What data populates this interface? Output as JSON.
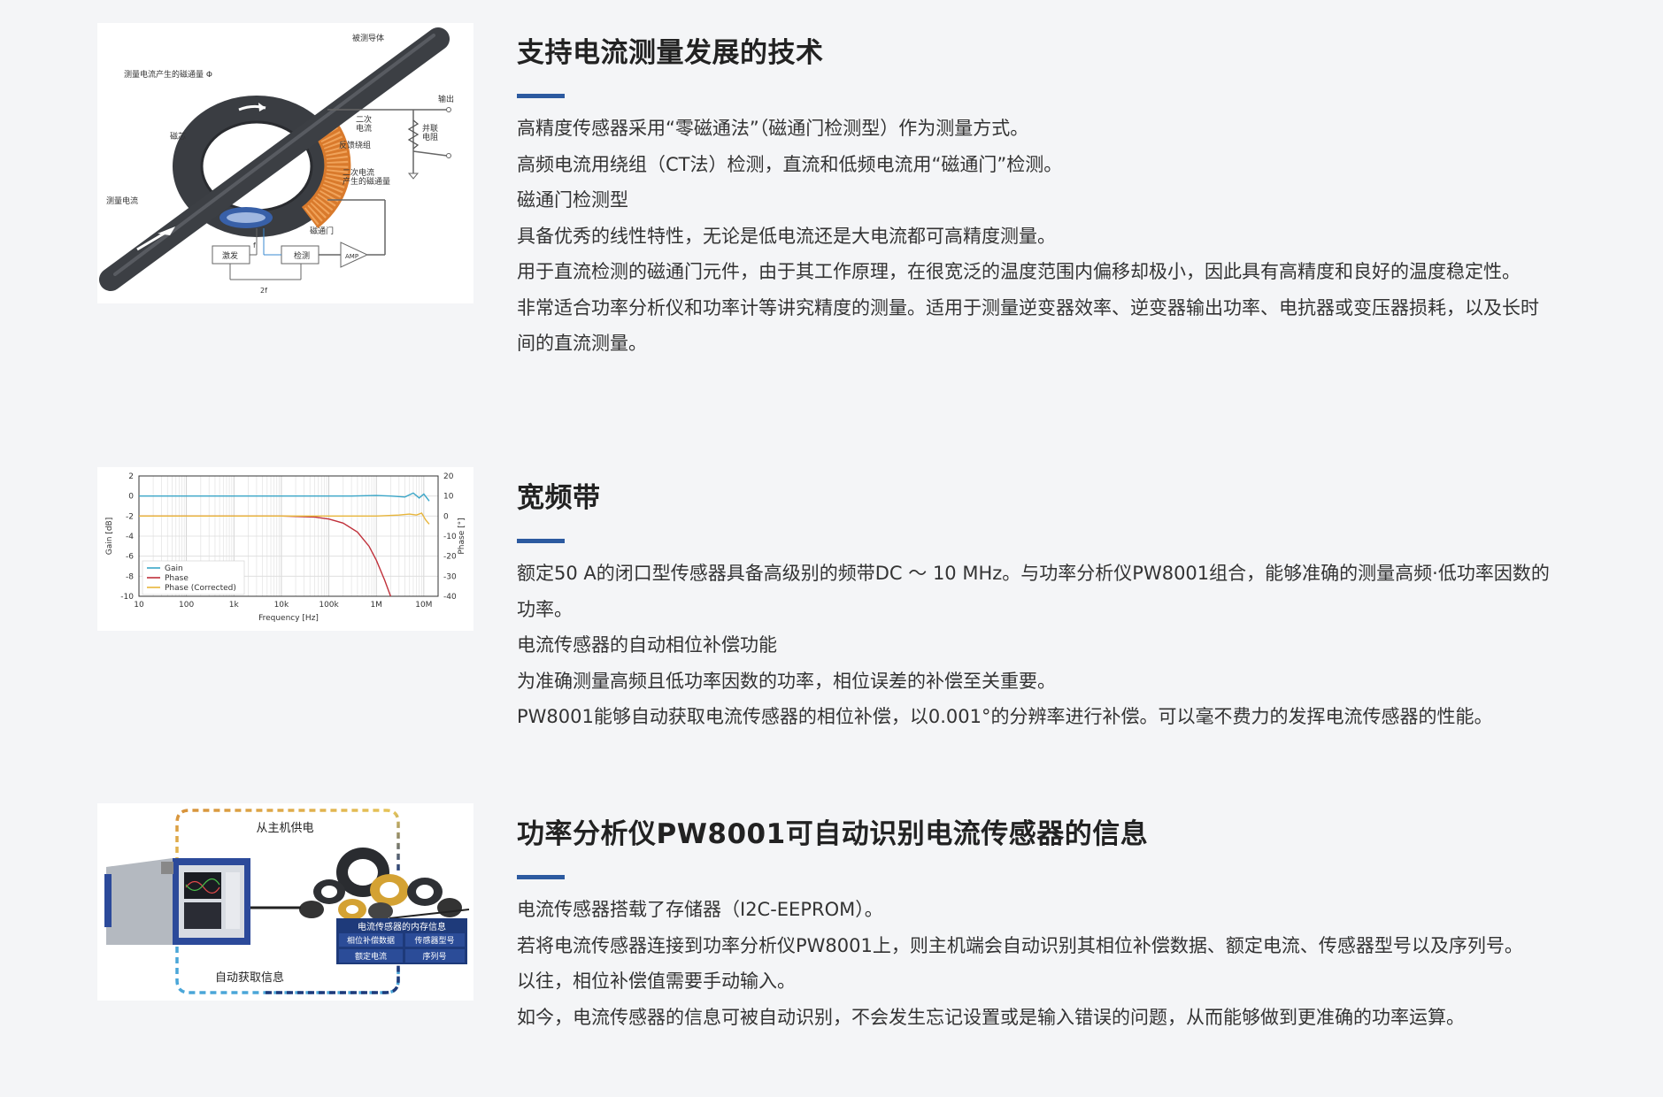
{
  "sections": [
    {
      "title": "支持电流测量发展的技术",
      "paragraphs": [
        "高精度传感器采用“零磁通法”（磁通门检测型）作为测量方式。",
        "高频电流用绕组（CT法）检测，直流和低频电流用“磁通门”检测。",
        "磁通门检测型",
        "具备优秀的线性特性，无论是低电流还是大电流都可高精度测量。",
        "用于直流检测的磁通门元件，由于其工作原理，在很宽泛的温度范围内偏移却极小，因此具有高精度和良好的温度稳定性。",
        "非常适合功率分析仪和功率计等讲究精度的测量。适用于测量逆变器效率、逆变器输出功率、电抗器或变压器损耗，以及长时间的直流测量。"
      ],
      "diagram": {
        "labels": {
          "conductor": "被测导体",
          "flux": "测量电流产生的磁通量 Φ",
          "output": "输出",
          "secondary_current": [
            "二次",
            "电流"
          ],
          "shunt": [
            "并联",
            "电阻"
          ],
          "core": "磁芯",
          "feedback": "反馈绕组",
          "secondary_flux": [
            "二次电流",
            "产生的磁通量"
          ],
          "current": "测量电流",
          "fluxgate": "磁通门",
          "excite": "激发",
          "detect": "检测",
          "amp": "AMP",
          "f": "f",
          "two_f": "2f"
        }
      }
    },
    {
      "title": "宽频带",
      "paragraphs": [
        "额定50 A的闭口型传感器具备高级别的频带DC ～ 10 MHz。与功率分析仪PW8001组合，能够准确的测量高频·低功率因数的功率。",
        "电流传感器的自动相位补偿功能",
        "为准确测量高频且低功率因数的功率，相位误差的补偿至关重要。",
        "PW8001能够自动获取电流传感器的相位补偿，以0.001°的分辨率进行补偿。可以毫不费力的发挥电流传感器的性能。"
      ],
      "chart_data": {
        "type": "line",
        "xlabel": "Frequency [Hz]",
        "ylabel": "Gain [dB]",
        "ylabel2": "Phase [°]",
        "xscale": "log",
        "xlim": [
          10,
          20000000
        ],
        "ylim": [
          -10,
          2
        ],
        "ylim2": [
          -40,
          20
        ],
        "x_ticks": [
          "10",
          "100",
          "1k",
          "10k",
          "100k",
          "1M",
          "10M"
        ],
        "y_ticks": [
          "2",
          "0",
          "-2",
          "-4",
          "-6",
          "-8",
          "-10"
        ],
        "y2_ticks": [
          "20",
          "10",
          "0",
          "-10",
          "-20",
          "-30",
          "-40"
        ],
        "grid": true,
        "legend": "bottom-left",
        "series": [
          {
            "name": "Gain",
            "axis": "left",
            "color": "#3aa6c8",
            "x": [
              10,
              100,
              1000,
              10000,
              100000,
              300000,
              1000000,
              2000000,
              4000000,
              6000000,
              8000000,
              10000000,
              13000000
            ],
            "y": [
              0,
              0,
              0,
              0,
              0,
              0,
              0.05,
              0,
              -0.1,
              0.3,
              -0.2,
              0.2,
              -0.5
            ]
          },
          {
            "name": "Phase",
            "axis": "right",
            "color": "#c0303a",
            "x": [
              10,
              10000,
              50000,
              100000,
              200000,
              400000,
              700000,
              1000000,
              1500000,
              2000000
            ],
            "y": [
              0,
              0,
              -0.5,
              -1.5,
              -3.5,
              -8,
              -15,
              -22,
              -32,
              -40
            ]
          },
          {
            "name": "Phase (Corrected)",
            "axis": "right",
            "color": "#e8b53a",
            "x": [
              10,
              1000000,
              3000000,
              5000000,
              7000000,
              9000000,
              11000000,
              13000000
            ],
            "y": [
              0,
              0,
              0.5,
              1,
              0.5,
              1.5,
              -2,
              -4
            ]
          }
        ]
      }
    },
    {
      "title": "功率分析仪PW8001可自动识别电流传感器的信息",
      "paragraphs": [
        "电流传感器搭载了存储器（I2C-EEPROM）。",
        "若将电流传感器连接到功率分析仪PW8001上，则主机端会自动识别其相位补偿数据、额定电流、传感器型号以及序列号。",
        "以往，相位补偿值需要手动输入。",
        "如今，电流传感器的信息可被自动识别，不会发生忘记设置或是输入错误的问题，从而能够做到更准确的功率运算。"
      ],
      "diagram": {
        "power_label": "从主机供电",
        "auto_label": "自动获取信息",
        "memory_title": "电流传感器的内存信息",
        "memory_cells": [
          "相位补偿数据",
          "传感器型号",
          "额定电流",
          "序列号"
        ]
      }
    }
  ]
}
